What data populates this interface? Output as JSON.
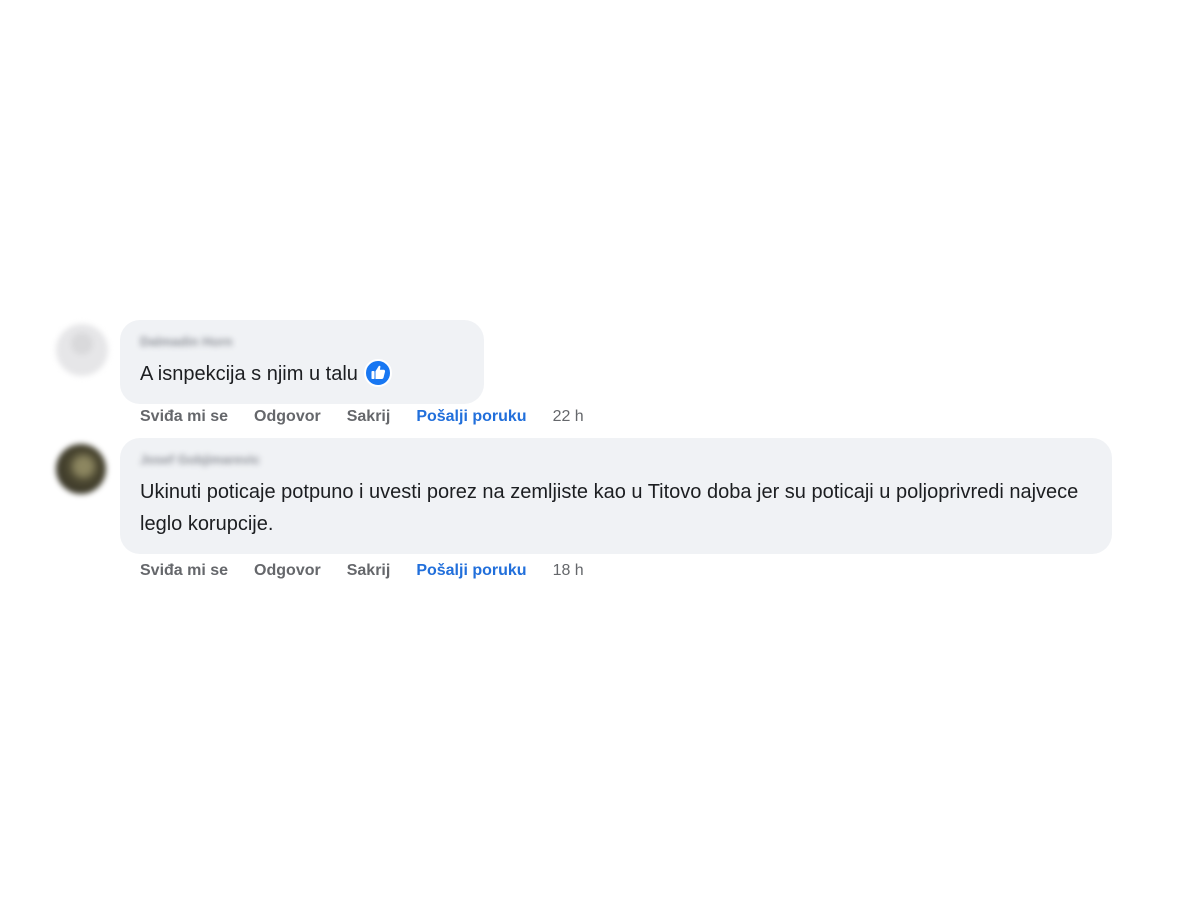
{
  "comments": [
    {
      "author": "Dalmadin Horn",
      "text": "A isnpekcija s njim u talu",
      "reaction_icon": "like-icon",
      "actions": {
        "like": "Sviđa mi se",
        "reply": "Odgovor",
        "hide": "Sakrij",
        "message": "Pošalji poruku"
      },
      "time": "22 h"
    },
    {
      "author": "Josef Gobjimarevic",
      "text": "Ukinuti poticaje potpuno i uvesti porez na zemljiste kao u Titovo doba jer su poticaji u poljoprivredi najvece leglo korupcije.",
      "actions": {
        "like": "Sviđa mi se",
        "reply": "Odgovor",
        "hide": "Sakrij",
        "message": "Pošalji poruku"
      },
      "time": "18 h"
    }
  ],
  "colors": {
    "bubble": "#f0f2f5",
    "text": "#1c1e21",
    "action_muted": "#65676b",
    "action_link": "#216fdb",
    "like_blue": "#1877f2"
  }
}
